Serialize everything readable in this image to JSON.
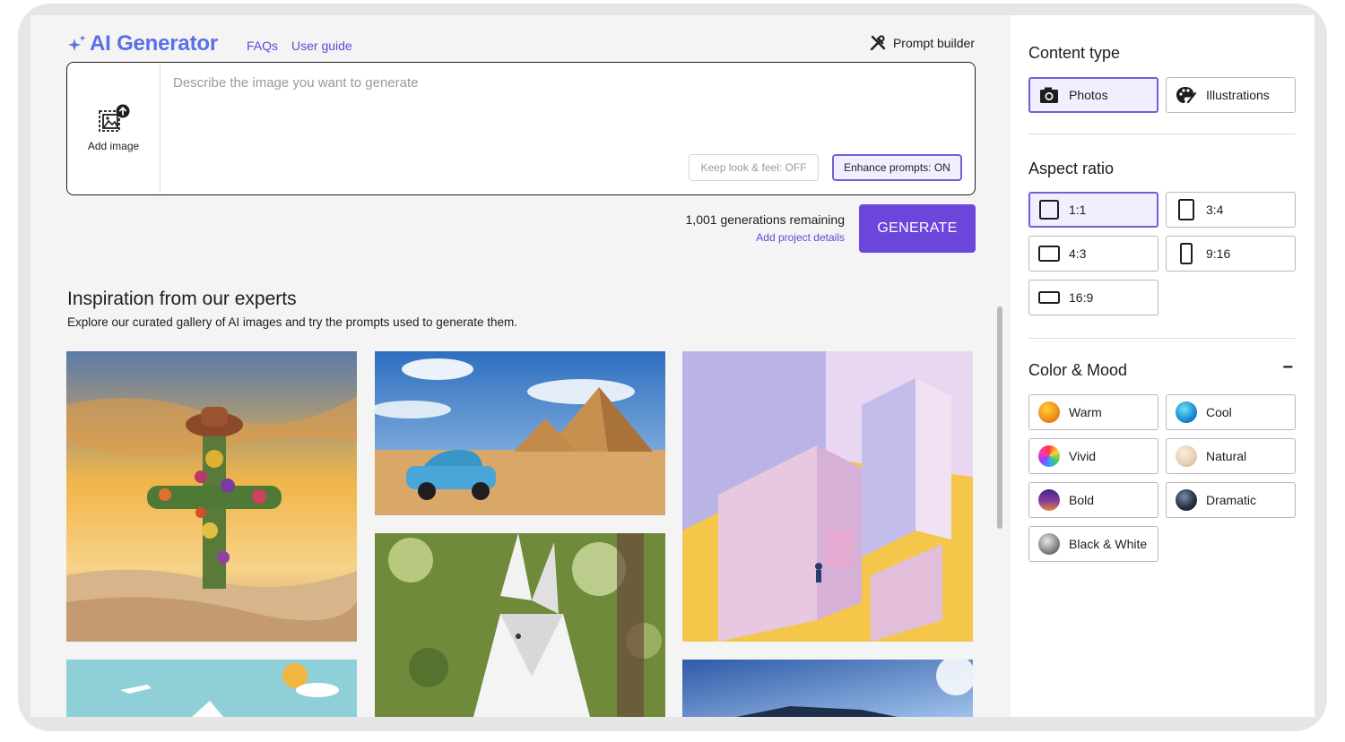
{
  "header": {
    "logo_text": "AI Generator",
    "links": [
      "FAQs",
      "User guide"
    ],
    "prompt_builder_label": "Prompt builder"
  },
  "prompt": {
    "add_image_label": "Add image",
    "placeholder": "Describe the image you want to generate",
    "value": "",
    "keep_look_label": "Keep look & feel: OFF",
    "enhance_label": "Enhance prompts: ON"
  },
  "generate": {
    "remaining_text": "1,001 generations remaining",
    "project_link": "Add project details",
    "button_label": "GENERATE"
  },
  "inspiration": {
    "title": "Inspiration from our experts",
    "subtitle": "Explore our curated gallery of AI images and try the prompts used to generate them."
  },
  "sidebar": {
    "content_type": {
      "title": "Content type",
      "options": [
        {
          "label": "Photos",
          "icon": "camera-icon",
          "selected": true
        },
        {
          "label": "Illustrations",
          "icon": "palette-icon",
          "selected": false
        }
      ]
    },
    "aspect_ratio": {
      "title": "Aspect ratio",
      "options": [
        {
          "label": "1:1",
          "selected": true
        },
        {
          "label": "3:4",
          "selected": false
        },
        {
          "label": "4:3",
          "selected": false
        },
        {
          "label": "9:16",
          "selected": false
        },
        {
          "label": "16:9",
          "selected": false
        }
      ]
    },
    "color_mood": {
      "title": "Color & Mood",
      "collapse_symbol": "−",
      "options": [
        {
          "label": "Warm",
          "icon": "warm-swatch-icon"
        },
        {
          "label": "Cool",
          "icon": "cool-swatch-icon"
        },
        {
          "label": "Vivid",
          "icon": "vivid-swatch-icon"
        },
        {
          "label": "Natural",
          "icon": "natural-swatch-icon"
        },
        {
          "label": "Bold",
          "icon": "bold-swatch-icon"
        },
        {
          "label": "Dramatic",
          "icon": "dramatic-swatch-icon"
        },
        {
          "label": "Black & White",
          "icon": "black-white-swatch-icon"
        }
      ]
    }
  },
  "colors": {
    "accent": "#6c46db",
    "logo": "#5b6fe6",
    "selected_bg": "#f1efff",
    "selected_border": "#7a5cd6"
  }
}
